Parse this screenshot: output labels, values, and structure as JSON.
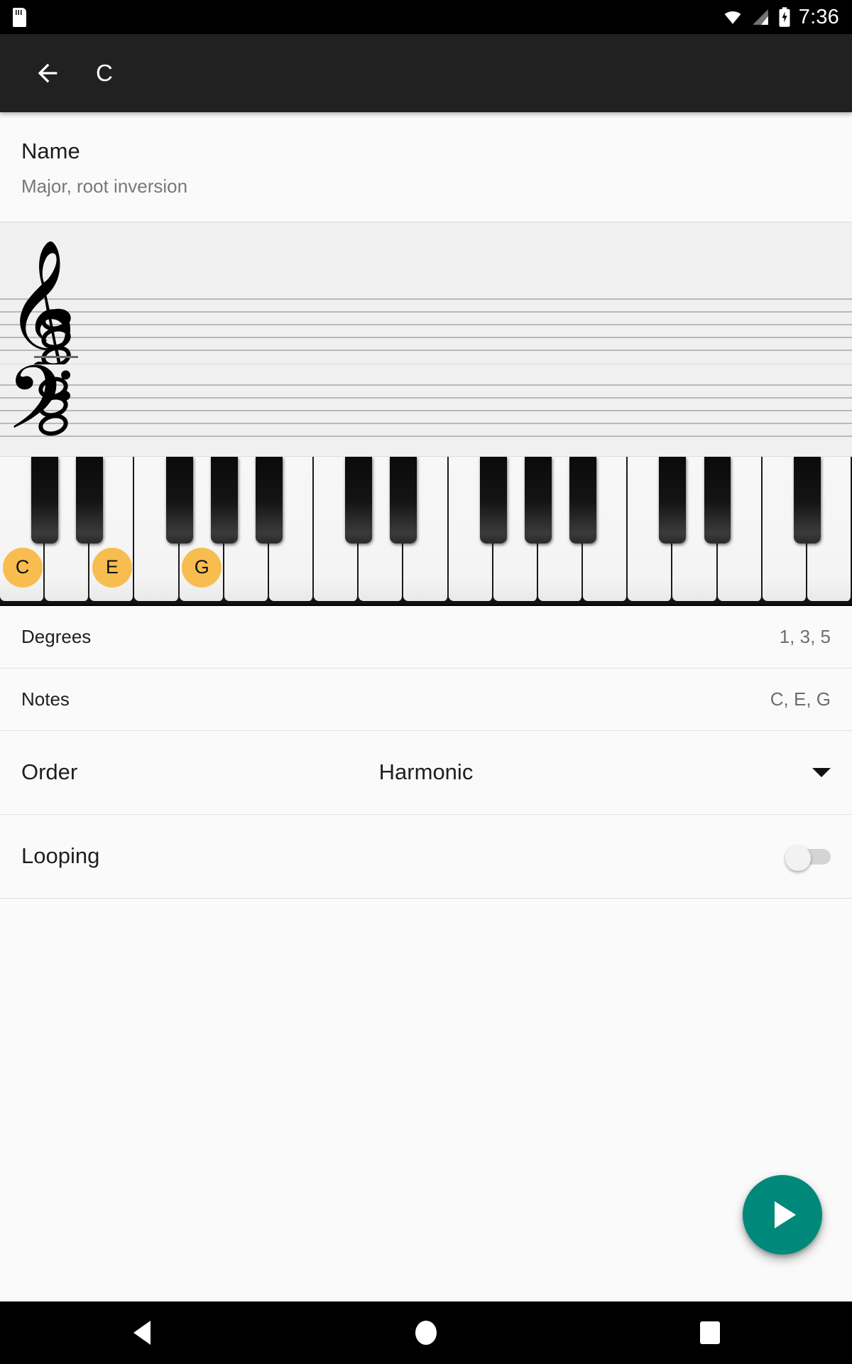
{
  "status_bar": {
    "time": "7:36",
    "icons": [
      "sdcard-icon",
      "wifi-icon",
      "cell-signal-icon",
      "battery-charging-icon"
    ]
  },
  "toolbar": {
    "back_icon": "arrow-back-icon",
    "title": "C"
  },
  "name_section": {
    "title": "Name",
    "subtitle": "Major, root inversion"
  },
  "notation": {
    "treble": {
      "clef": "treble-clef",
      "clef_glyph": "𝄞",
      "notes": [
        "C4",
        "E4",
        "G4"
      ],
      "ledger_line_on_lowest": true
    },
    "bass": {
      "clef": "bass-clef",
      "clef_glyph": "𝄢",
      "notes": [
        "C3",
        "E3",
        "G3"
      ],
      "ledger_line_on_lowest": false
    }
  },
  "piano": {
    "start_note": "C",
    "white_key_count": 19,
    "highlight_color": "#f8bd4f",
    "highlighted": [
      {
        "white_index": 0,
        "label": "C"
      },
      {
        "white_index": 2,
        "label": "E"
      },
      {
        "white_index": 4,
        "label": "G"
      }
    ]
  },
  "rows": [
    {
      "label": "Degrees",
      "value": "1, 3, 5"
    },
    {
      "label": "Notes",
      "value": "C, E, G"
    }
  ],
  "order_row": {
    "label": "Order",
    "value": "Harmonic",
    "caret_icon": "chevron-down-icon",
    "options": [
      "Harmonic"
    ]
  },
  "looping_row": {
    "label": "Looping",
    "enabled": false
  },
  "fab": {
    "icon": "play-icon",
    "color": "#00897b"
  },
  "nav_bar": {
    "back": "nav-back-icon",
    "home": "nav-home-icon",
    "recents": "nav-recents-icon"
  }
}
